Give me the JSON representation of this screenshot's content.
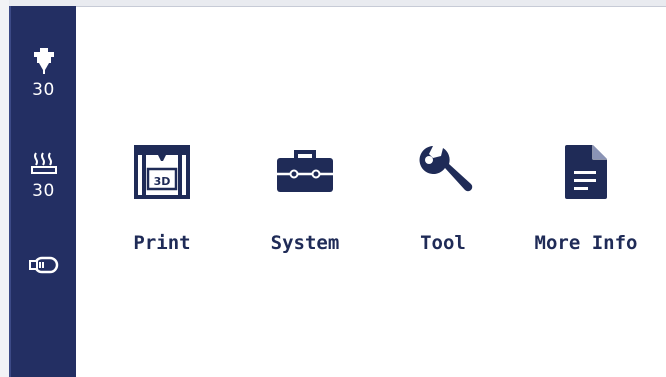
{
  "colors": {
    "sidebar_bg": "#232f63",
    "accent": "#1f2b57",
    "background": "#ffffff"
  },
  "sidebar": {
    "nozzle": {
      "icon": "nozzle-icon",
      "temperature": "30"
    },
    "bed": {
      "icon": "heated-bed-icon",
      "temperature": "30"
    },
    "filament": {
      "icon": "filament-spool-icon"
    }
  },
  "menu": {
    "items": [
      {
        "id": "print",
        "label": "Print",
        "icon": "printer-3d-icon"
      },
      {
        "id": "system",
        "label": "System",
        "icon": "toolbox-icon"
      },
      {
        "id": "tool",
        "label": "Tool",
        "icon": "wrench-icon"
      },
      {
        "id": "more_info",
        "label": "More Info",
        "icon": "document-icon"
      }
    ]
  }
}
